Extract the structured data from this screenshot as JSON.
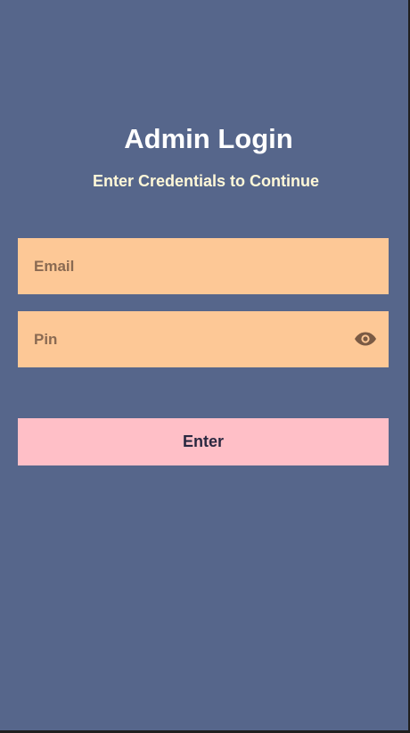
{
  "header": {
    "title": "Admin Login",
    "subtitle": "Enter Credentials to Continue"
  },
  "form": {
    "email": {
      "placeholder": "Email",
      "value": ""
    },
    "pin": {
      "placeholder": "Pin",
      "value": "",
      "toggle_icon": "eye-icon"
    },
    "submit_label": "Enter"
  },
  "colors": {
    "background": "#56668B",
    "field": "#FDC896",
    "button": "#FFBFC7",
    "title": "#FFFFFF",
    "subtitle": "#FFF8D8",
    "icon": "#7A5A44"
  }
}
